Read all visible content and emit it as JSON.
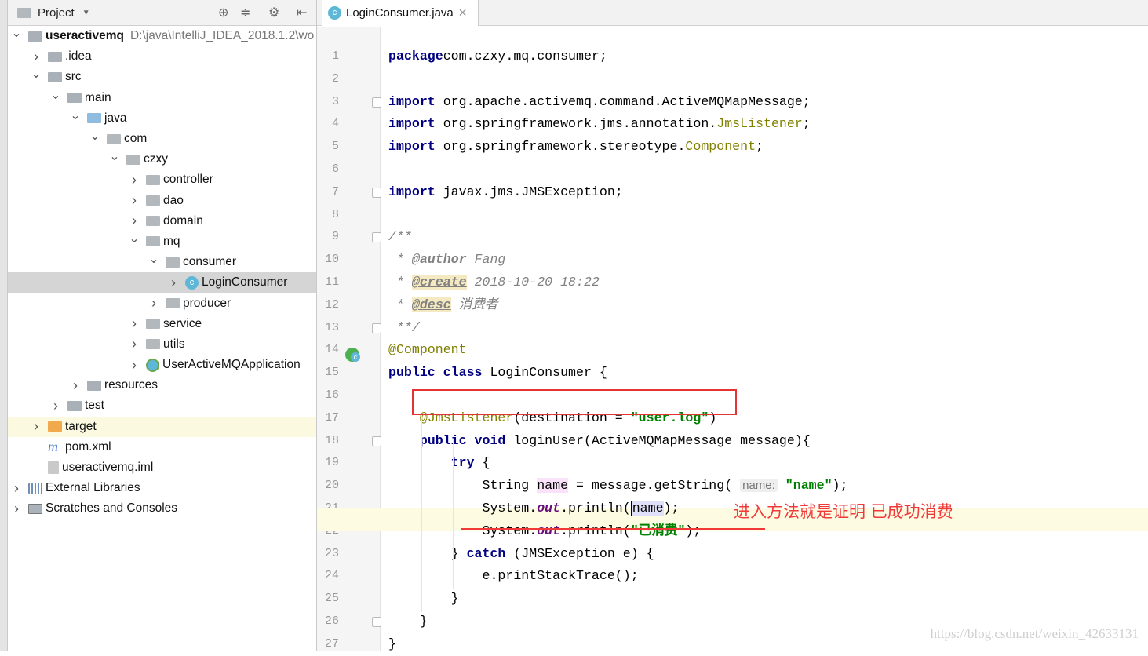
{
  "project_panel": {
    "title": "Project",
    "tree": [
      {
        "label": "useractivemq",
        "path": "D:\\java\\IntelliJ_IDEA_2018.1.2\\wo",
        "indent": 0,
        "arrow": "down",
        "icon": "module",
        "bold": true
      },
      {
        "label": ".idea",
        "indent": 1,
        "arrow": "right",
        "icon": "folder"
      },
      {
        "label": "src",
        "indent": 1,
        "arrow": "down",
        "icon": "folder"
      },
      {
        "label": "main",
        "indent": 2,
        "arrow": "down",
        "icon": "folder"
      },
      {
        "label": "java",
        "indent": 3,
        "arrow": "down",
        "icon": "src"
      },
      {
        "label": "com",
        "indent": 4,
        "arrow": "down",
        "icon": "pkg"
      },
      {
        "label": "czxy",
        "indent": 5,
        "arrow": "down",
        "icon": "pkg"
      },
      {
        "label": "controller",
        "indent": 6,
        "arrow": "right",
        "icon": "pkg"
      },
      {
        "label": "dao",
        "indent": 6,
        "arrow": "right",
        "icon": "pkg"
      },
      {
        "label": "domain",
        "indent": 6,
        "arrow": "right",
        "icon": "pkg"
      },
      {
        "label": "mq",
        "indent": 6,
        "arrow": "down",
        "icon": "pkg"
      },
      {
        "label": "consumer",
        "indent": 7,
        "arrow": "down",
        "icon": "pkg"
      },
      {
        "label": "LoginConsumer",
        "indent": 8,
        "arrow": "right",
        "icon": "class",
        "selected": true
      },
      {
        "label": "producer",
        "indent": 7,
        "arrow": "right",
        "icon": "pkg"
      },
      {
        "label": "service",
        "indent": 6,
        "arrow": "right",
        "icon": "pkg"
      },
      {
        "label": "utils",
        "indent": 6,
        "arrow": "right",
        "icon": "pkg"
      },
      {
        "label": "UserActiveMQApplication",
        "indent": 6,
        "arrow": "right",
        "icon": "app"
      },
      {
        "label": "resources",
        "indent": 3,
        "arrow": "right",
        "icon": "folder"
      },
      {
        "label": "test",
        "indent": 2,
        "arrow": "right",
        "icon": "folder"
      },
      {
        "label": "target",
        "indent": 1,
        "arrow": "right",
        "icon": "orange",
        "highlight": true
      },
      {
        "label": "pom.xml",
        "indent": 1,
        "arrow": "",
        "icon": "maven"
      },
      {
        "label": "useractivemq.iml",
        "indent": 1,
        "arrow": "",
        "icon": "file"
      },
      {
        "label": "External Libraries",
        "indent": 0,
        "arrow": "right",
        "icon": "lib"
      },
      {
        "label": "Scratches and Consoles",
        "indent": 0,
        "arrow": "right",
        "icon": "scratch"
      }
    ]
  },
  "editor": {
    "tab_label": "LoginConsumer.java",
    "current_line": 21,
    "lines": [
      [
        [
          "kw",
          "package"
        ],
        [
          "",
          "com.czxy.mq.consumer;"
        ]
      ],
      [],
      [
        [
          "kw",
          "import"
        ],
        [
          "",
          " org.apache.activemq.command.ActiveMQMapMessage;"
        ]
      ],
      [
        [
          "kw",
          "import"
        ],
        [
          "",
          " org.springframework.jms.annotation."
        ],
        [
          "ann",
          "JmsListener"
        ],
        [
          "",
          ";"
        ]
      ],
      [
        [
          "kw",
          "import"
        ],
        [
          "",
          " org.springframework.stereotype."
        ],
        [
          "ann",
          "Component"
        ],
        [
          "",
          ";"
        ]
      ],
      [],
      [
        [
          "kw",
          "import"
        ],
        [
          "",
          " javax.jms.JMSException;"
        ]
      ],
      [],
      [
        [
          "cm",
          "/**"
        ]
      ],
      [
        [
          "cm",
          " * "
        ],
        [
          "tag",
          "@author"
        ],
        [
          "cm",
          " Fang"
        ]
      ],
      [
        [
          "cm",
          " * "
        ],
        [
          "tag tagbg",
          "@create"
        ],
        [
          "cm",
          " 2018-10-20 18:22"
        ]
      ],
      [
        [
          "cm",
          " * "
        ],
        [
          "tag tagbg",
          "@desc"
        ],
        [
          "cm",
          " 消费者"
        ]
      ],
      [
        [
          "cm",
          " **/"
        ]
      ],
      [
        [
          "ann",
          "@Component"
        ]
      ],
      [
        [
          "kw",
          "public class"
        ],
        [
          "",
          " LoginConsumer {"
        ]
      ],
      [],
      [
        [
          "",
          "    "
        ],
        [
          "ann",
          "@JmsListener"
        ],
        [
          "",
          "(destination = "
        ],
        [
          "str",
          "\"user.log\""
        ],
        [
          "",
          ")"
        ]
      ],
      [
        [
          "",
          "    "
        ],
        [
          "kw",
          "public void"
        ],
        [
          "",
          " loginUser(ActiveMQMapMessage message){"
        ]
      ],
      [
        [
          "",
          "        "
        ],
        [
          "kw",
          "try"
        ],
        [
          "",
          " {"
        ]
      ],
      [
        [
          "",
          "            String "
        ],
        [
          "var1",
          "name"
        ],
        [
          "",
          " = message.getString( "
        ],
        [
          "hint",
          "name:"
        ],
        [
          "str",
          " \"name\""
        ],
        [
          "",
          ");"
        ]
      ],
      [
        [
          "",
          "            System."
        ],
        [
          "it",
          "out"
        ],
        [
          "",
          ".println("
        ],
        [
          "var2",
          "name"
        ],
        [
          "",
          ");"
        ]
      ],
      [
        [
          "",
          "            System."
        ],
        [
          "it",
          "out"
        ],
        [
          "",
          ".println("
        ],
        [
          "str",
          "\"已消费\""
        ],
        [
          "",
          ");"
        ]
      ],
      [
        [
          "",
          "        } "
        ],
        [
          "kw",
          "catch"
        ],
        [
          "",
          " (JMSException e) {"
        ]
      ],
      [
        [
          "",
          "            e.printStackTrace();"
        ]
      ],
      [
        [
          "",
          "        }"
        ]
      ],
      [
        [
          "",
          "    }"
        ]
      ],
      [
        [
          "",
          "}"
        ]
      ]
    ]
  },
  "annotation_note": "进入方法就是证明  已成功消费",
  "watermark": "https://blog.csdn.net/weixin_42633131",
  "colors": {
    "keyword": "#000080",
    "annotation": "#808000",
    "string": "#008000",
    "red_markup": "#e53333"
  }
}
